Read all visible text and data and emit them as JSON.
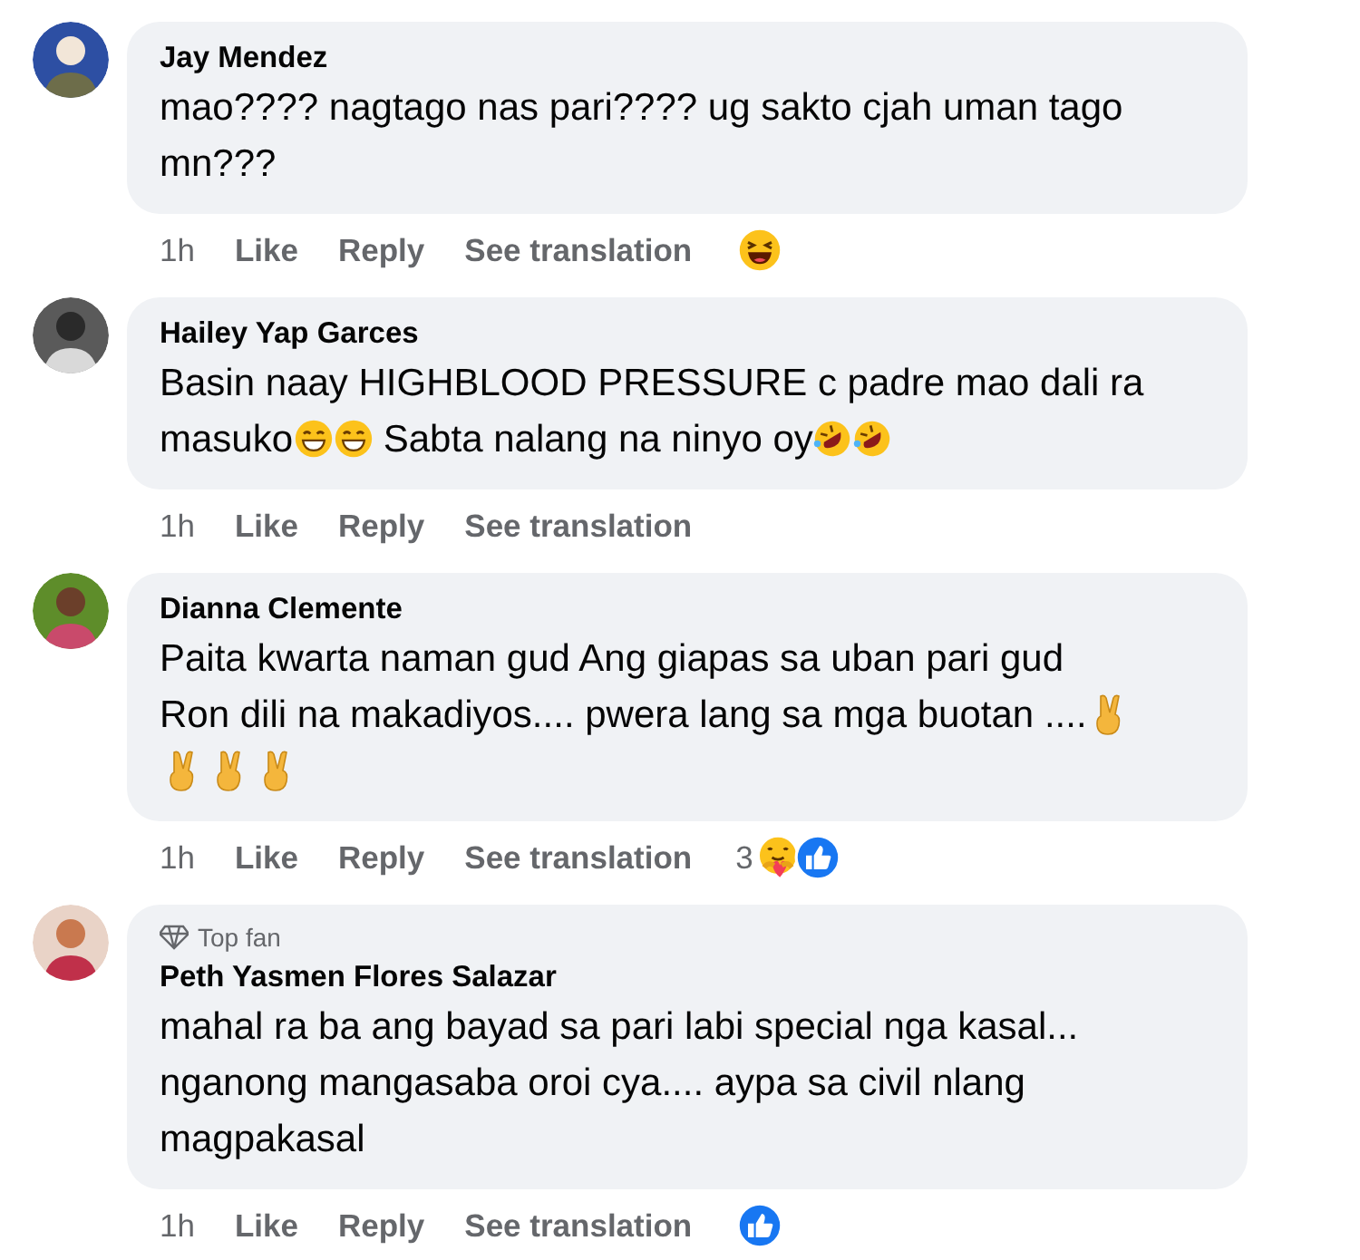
{
  "comments": [
    {
      "author": "Jay Mendez",
      "lines": [
        [
          {
            "kind": "text",
            "text": "mao???? nagtago nas pari???? ug sakto cjah uman tago"
          }
        ],
        [
          {
            "kind": "text",
            "text": "mn???"
          }
        ]
      ],
      "time": "1h",
      "actions": [
        "Like",
        "Reply",
        "See translation"
      ],
      "reactions": [
        {
          "kind": "haha"
        }
      ]
    },
    {
      "author": "Hailey Yap Garces",
      "lines": [
        [
          {
            "kind": "text",
            "text": "Basin naay HIGHBLOOD PRESSURE c padre mao dali ra"
          }
        ],
        [
          {
            "kind": "text",
            "text": "masuko"
          },
          {
            "kind": "grin"
          },
          {
            "kind": "grin"
          },
          {
            "kind": "text",
            "text": " Sabta nalang na ninyo oy"
          },
          {
            "kind": "rofl"
          },
          {
            "kind": "rofl"
          }
        ]
      ],
      "time": "1h",
      "actions": [
        "Like",
        "Reply",
        "See translation"
      ]
    },
    {
      "author": "Dianna Clemente",
      "lines": [
        [
          {
            "kind": "text",
            "text": "Paita kwarta naman gud Ang giapas sa uban pari gud"
          }
        ],
        [
          {
            "kind": "text",
            "text": "Ron dili na makadiyos.... pwera lang sa mga buotan ...."
          },
          {
            "kind": "peace"
          }
        ],
        [
          {
            "kind": "peace"
          },
          {
            "kind": "peace"
          },
          {
            "kind": "peace"
          }
        ]
      ],
      "time": "1h",
      "actions": [
        "Like",
        "Reply",
        "See translation"
      ],
      "reaction_count": "3",
      "reactions": [
        {
          "kind": "care"
        },
        {
          "kind": "like"
        }
      ]
    },
    {
      "author": "Peth Yasmen Flores Salazar",
      "badge": "Top fan",
      "lines": [
        [
          {
            "kind": "text",
            "text": "mahal ra ba ang bayad sa pari labi special nga kasal..."
          }
        ],
        [
          {
            "kind": "text",
            "text": "nganong mangasaba oroi cya.... aypa sa civil nlang"
          }
        ],
        [
          {
            "kind": "text",
            "text": "magpakasal"
          }
        ]
      ],
      "time": "1h",
      "actions": [
        "Like",
        "Reply",
        "See translation"
      ],
      "reactions": [
        {
          "kind": "like"
        }
      ]
    }
  ]
}
